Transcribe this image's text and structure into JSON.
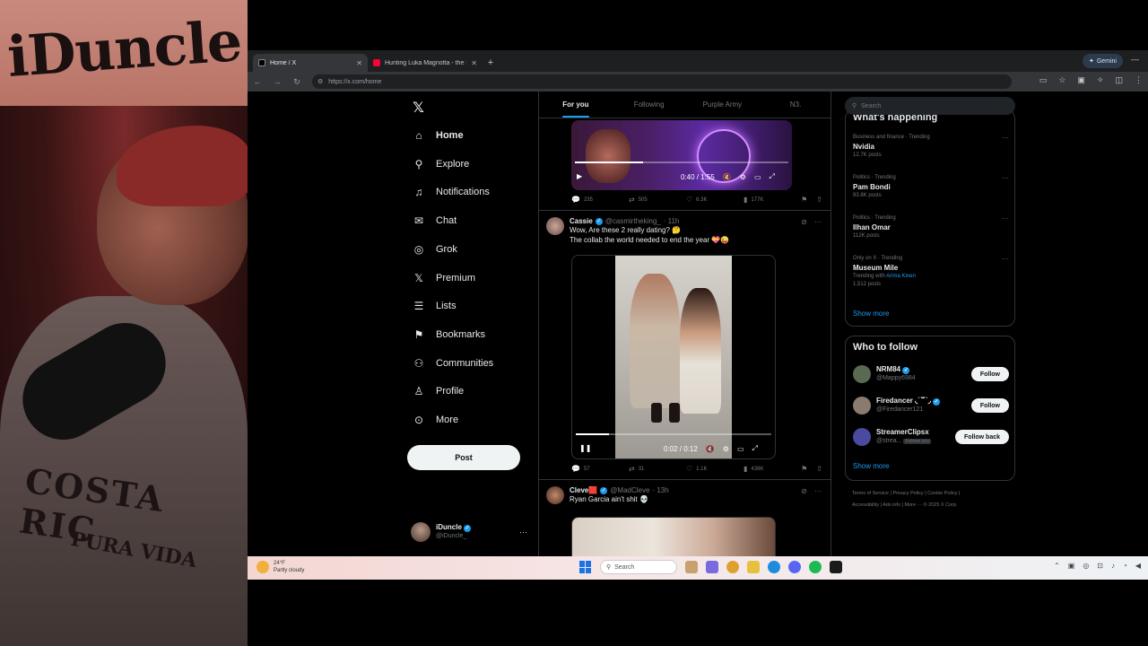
{
  "webcam": {
    "banner_text": "iDuncle",
    "shirt_text": "COSTA RIC",
    "shirt_sub": "PURA VIDA"
  },
  "browser": {
    "tabs": [
      {
        "title": "Home / X",
        "favicon_color": "#e7e9ea",
        "active": true
      },
      {
        "title": "Hunting Luka Magnotta - the I",
        "favicon_color": "#ff0033",
        "active": false
      }
    ],
    "new_tab": "+",
    "gemini_label": "Gemini",
    "url": "https://x.com/home"
  },
  "nav": {
    "items": [
      {
        "label": "Home",
        "icon": "home-icon",
        "glyph": "⌂"
      },
      {
        "label": "Explore",
        "icon": "search-icon",
        "glyph": "⚲"
      },
      {
        "label": "Notifications",
        "icon": "bell-icon",
        "glyph": "♫"
      },
      {
        "label": "Chat",
        "icon": "mail-icon",
        "glyph": "✉"
      },
      {
        "label": "Grok",
        "icon": "grok-icon",
        "glyph": "◎"
      },
      {
        "label": "Premium",
        "icon": "x-logo-icon",
        "glyph": "𝕏"
      },
      {
        "label": "Lists",
        "icon": "list-icon",
        "glyph": "☰"
      },
      {
        "label": "Bookmarks",
        "icon": "bookmark-icon",
        "glyph": "⚑"
      },
      {
        "label": "Communities",
        "icon": "people-icon",
        "glyph": "⚇"
      },
      {
        "label": "Profile",
        "icon": "person-icon",
        "glyph": "♙"
      },
      {
        "label": "More",
        "icon": "more-circle-icon",
        "glyph": "⊙"
      }
    ],
    "post_label": "Post",
    "account": {
      "name": "iDuncle",
      "handle": "@iDuncle_"
    }
  },
  "timeline": {
    "tabs": [
      "For you",
      "Following",
      "Purple Army",
      "N3."
    ],
    "active_tab": 0,
    "tweet1": {
      "video_time": "0:40 / 1:55",
      "progress": 0.32,
      "stats": {
        "replies": "235",
        "reposts": "505",
        "likes": "6.3K",
        "views": "177K"
      }
    },
    "tweet2": {
      "name": "Cassie",
      "handle": "@casmirtheking_",
      "time": "· 11h",
      "line1": "Wow, Are these 2 really dating? 🤔",
      "line2": "The collab the world needed to end the year 💝😜",
      "video_time": "0:02 / 0:12",
      "progress": 0.17,
      "stats": {
        "replies": "57",
        "reposts": "31",
        "likes": "1.1K",
        "views": "438K"
      }
    },
    "tweet3": {
      "name": "Cleve🟥",
      "handle": "@MadCleve",
      "time": "· 13h",
      "text": "Ryan Garcia ain't shit 💀"
    }
  },
  "sidebar": {
    "search_placeholder": "Search",
    "whats_happening": "What's happening",
    "trends": [
      {
        "category": "Business and finance · Trending",
        "name": "Nvidia",
        "sub": "12.7K posts"
      },
      {
        "category": "Politics · Trending",
        "name": "Pam Bondi",
        "sub": "93.8K posts"
      },
      {
        "category": "Politics · Trending",
        "name": "Ilhan Omar",
        "sub": "112K posts"
      },
      {
        "category": "Only on X · Trending",
        "name": "Museum Mile",
        "sub_prefix": "Trending with ",
        "sub_highlight": "Arima Kinen",
        "sub": "1,512 posts"
      }
    ],
    "show_more": "Show more",
    "who_to_follow": "Who to follow",
    "follow_suggestions": [
      {
        "name": "NRM84",
        "handle": "@Mappy6984",
        "button": "Follow",
        "avatar_color": "#5a6a52"
      },
      {
        "name": "Firedancer ◟ˊ꒳ˋ◞",
        "handle": "@Firedancer121",
        "button": "Follow",
        "avatar_color": "#8a7a70"
      },
      {
        "name": "StreamerClipsx",
        "handle": "@strea...",
        "button": "Follow back",
        "follows_you": "Follows you",
        "avatar_color": "#4a4aa0"
      }
    ],
    "footer_line1": "Terms of Service  |  Privacy Policy  |  Cookie Policy  |",
    "footer_line2": "Accessibility  |  Ads info  |  More ···  © 2025 X Corp."
  },
  "taskbar": {
    "temp": "24°F",
    "condition": "Partly cloudy",
    "search_label": "Search"
  }
}
